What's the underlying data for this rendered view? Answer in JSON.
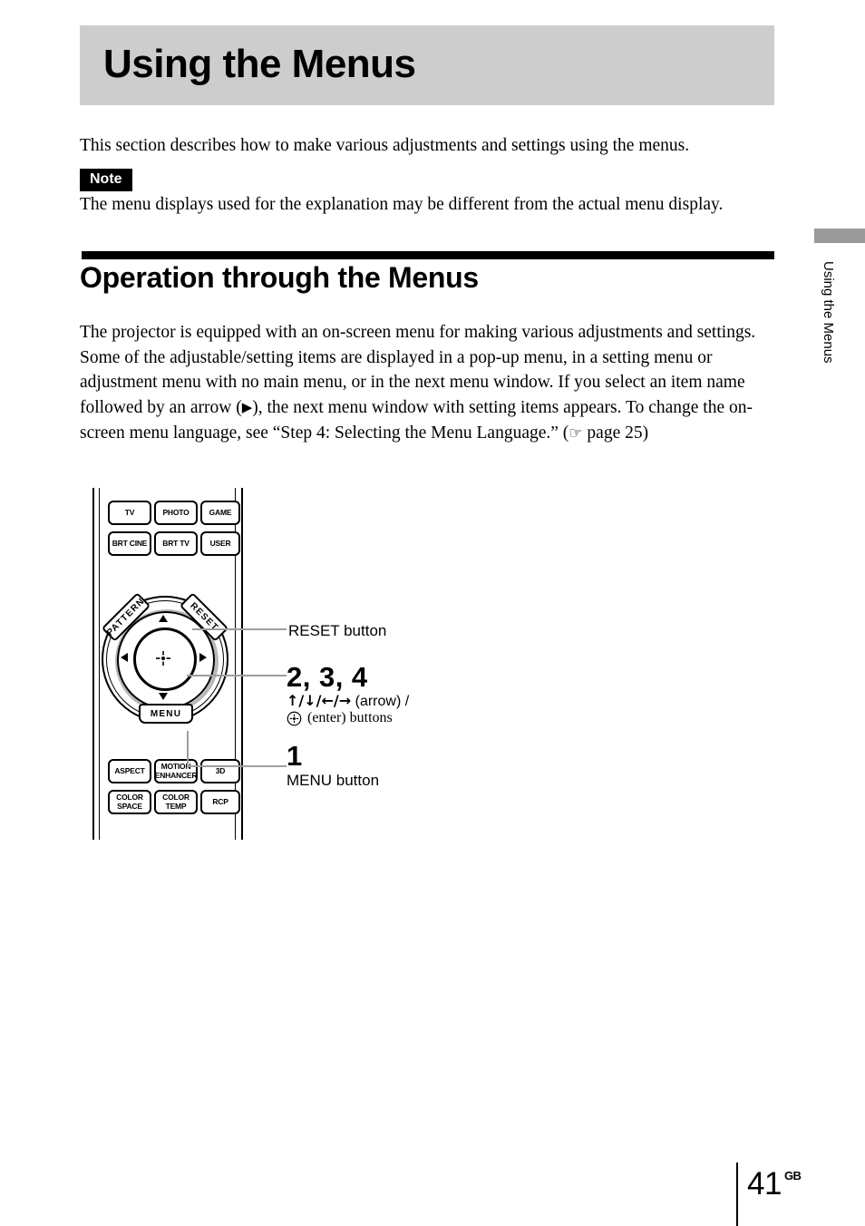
{
  "header": {
    "title": "Using the Menus"
  },
  "intro": {
    "paragraph": "This section describes how to make various adjustments and settings using the menus.",
    "note_label": "Note",
    "note_text": "The menu displays used for the explanation may be different from the actual menu display."
  },
  "section": {
    "heading": "Operation through the Menus",
    "paragraph_part1": "The projector is equipped with an on-screen menu for making various adjustments and settings. Some of the adjustable/setting items are displayed in a pop-up menu, in a setting menu or adjustment menu with no main menu, or in the next menu window. If you select an item name followed by an arrow (",
    "arrow_glyph": "▶",
    "paragraph_part2": "), the next menu window with setting items appears. To change the on-screen menu language, see “Step 4: Selecting the Menu Language.” (",
    "hand_glyph": "☞",
    "paragraph_part3": " page 25)"
  },
  "side_tab": {
    "label": "Using the Menus",
    "block_color": "#9a9a9a"
  },
  "footer": {
    "page_number": "41",
    "region": "GB"
  },
  "remote": {
    "buttons_top": [
      {
        "lines": [
          "TV"
        ]
      },
      {
        "lines": [
          "PHOTO"
        ]
      },
      {
        "lines": [
          "GAME"
        ]
      },
      {
        "lines": [
          "BRT CINE"
        ]
      },
      {
        "lines": [
          "BRT TV"
        ]
      },
      {
        "lines": [
          "USER"
        ]
      }
    ],
    "buttons_bottom": [
      {
        "lines": [
          "ASPECT"
        ]
      },
      {
        "lines": [
          "MOTION",
          "ENHANCER"
        ]
      },
      {
        "lines": [
          "3D"
        ]
      },
      {
        "lines": [
          "COLOR",
          "SPACE"
        ]
      },
      {
        "lines": [
          "COLOR",
          "TEMP"
        ]
      },
      {
        "lines": [
          "RCP"
        ]
      }
    ],
    "pad": {
      "pattern_label": "PATTERN",
      "reset_label": "RESET",
      "menu_label": "MENU"
    }
  },
  "callouts": {
    "reset": "RESET button",
    "step_234": "2, 3, 4",
    "arrow_glyphs": "↑/↓/←/→",
    "arrow_desc": "(arrow) /",
    "enter_desc": "(enter) buttons",
    "step_1": "1",
    "menu": "MENU button"
  },
  "colors": {
    "banner_gray": "#cdcdcd",
    "leader_gray": "#9e9e9e",
    "ink": "#000000"
  }
}
